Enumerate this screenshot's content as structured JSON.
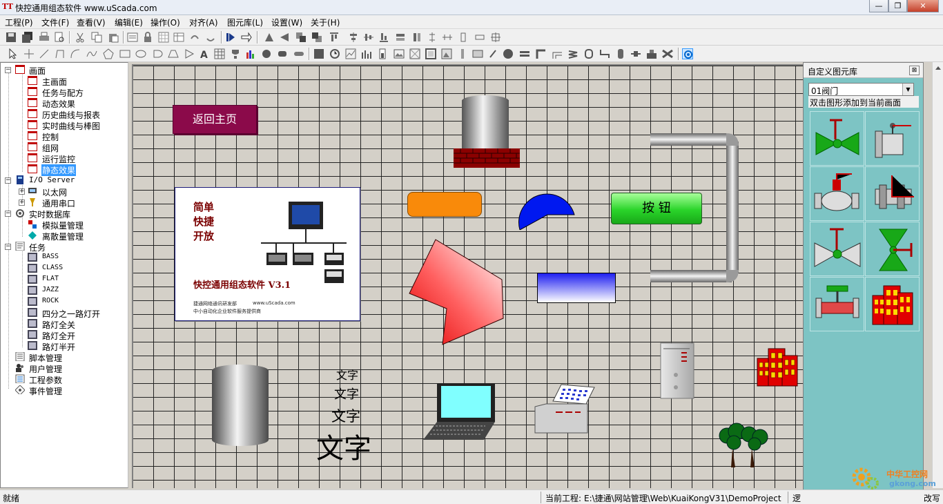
{
  "window": {
    "title": "快控通用组态软件 www.uScada.com",
    "app_icon": "TT",
    "minimize": "—",
    "restore": "❐",
    "close": "✕"
  },
  "menu": [
    "工程(P)",
    "文件(F)",
    "查看(V)",
    "编辑(E)",
    "操作(O)",
    "对齐(A)",
    "图元库(L)",
    "设置(W)",
    "关于(H)"
  ],
  "tree": {
    "screens_root": "画面",
    "screens": [
      "主画面",
      "任务与配方",
      "动态效果",
      "历史曲线与报表",
      "实时曲线与棒图",
      "控制",
      "组网",
      "运行监控",
      "静态效果"
    ],
    "selected": "静态效果",
    "io_root": "I/O Server",
    "io": [
      "以太网",
      "通用串口"
    ],
    "db_root": "实时数据库",
    "db": [
      "模拟量管理",
      "离散量管理"
    ],
    "task_root": "任务",
    "tasks": [
      "BASS",
      "CLASS",
      "FLAT",
      "JAZZ",
      "ROCK",
      "四分之一路灯开",
      "路灯全关",
      "路灯全开",
      "路灯半开"
    ],
    "others": [
      "脚本管理",
      "用户管理",
      "工程参数",
      "事件管理"
    ]
  },
  "canvas": {
    "home_button": "返回主页",
    "push_button": "按 钮",
    "banner": {
      "line1": "简单",
      "line2": "快捷",
      "line3": "开放",
      "product": "快控通用组态软件 V3.1",
      "company": "捷通网络通讯研发部",
      "url": "www.uScada.com",
      "slogan": "中小自动化企业软件服务提供商"
    },
    "text_samples": [
      "文字",
      "文字",
      "文字",
      "文字"
    ]
  },
  "library": {
    "title": "自定义图元库",
    "close": "⊠",
    "category": "01阀门",
    "hint": "双击图形添加到当前画面"
  },
  "status": {
    "left": "就绪",
    "project_label": "当前工程:",
    "project_path": "E:\\捷通\\网站管理\\Web\\KuaiKongV31\\DemoProject",
    "mode": "逻",
    "caps": "改写"
  },
  "watermark": {
    "cn": "中华工控网",
    "en": "gkong.com"
  }
}
